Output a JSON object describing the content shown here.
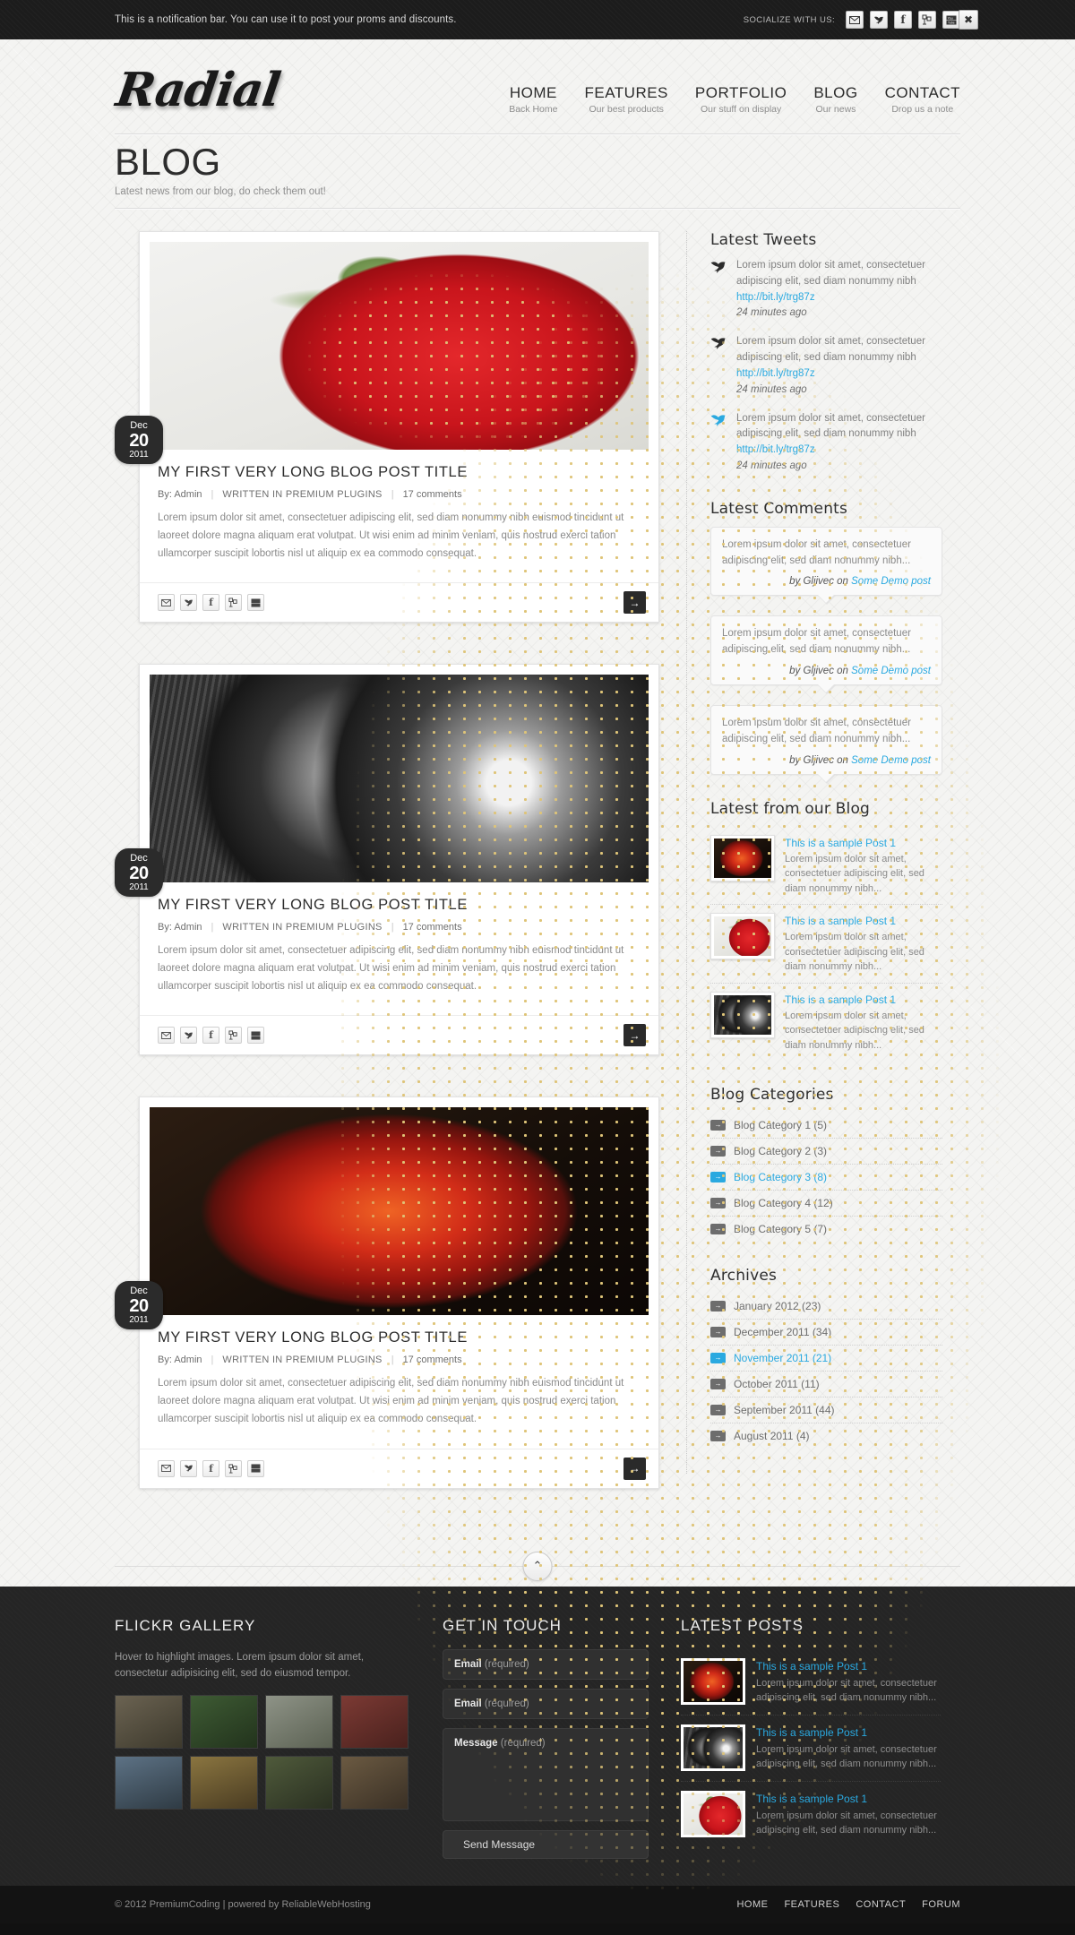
{
  "notification": {
    "text": "This is a notification bar. You can use it to post your proms and discounts.",
    "socialize_label": "SOCIALIZE WITH US:",
    "icons": [
      "mail-icon",
      "twitter-icon",
      "facebook-icon",
      "flickr-icon",
      "youtube-icon"
    ],
    "close_label": "✖"
  },
  "header": {
    "logo": "Radial",
    "nav": [
      {
        "title": "HOME",
        "sub": "Back Home"
      },
      {
        "title": "FEATURES",
        "sub": "Our best products"
      },
      {
        "title": "PORTFOLIO",
        "sub": "Our stuff on display"
      },
      {
        "title": "BLOG",
        "sub": "Our news"
      },
      {
        "title": "CONTACT",
        "sub": "Drop us a note"
      }
    ]
  },
  "page": {
    "title": "BLOG",
    "subtitle": "Latest news from our blog, do check them out!"
  },
  "posts": [
    {
      "image": "img-strawberry",
      "date": {
        "month": "Dec",
        "day": "20",
        "year": "2011"
      },
      "title": "MY FIRST VERY LONG BLOG POST TITLE",
      "author": "By: Admin",
      "category": "WRITTEN IN PREMIUM PLUGINS",
      "comments": "17 comments",
      "excerpt": "Lorem ipsum dolor sit amet, consectetuer adipiscing elit, sed diam nonummy nibh euismod tincidunt ut laoreet dolore magna aliquam erat volutpat. Ut wisi enim ad minim veniam, quis nostrud exerci tation ullamcorper suscipit lobortis nisl ut aliquip ex ea commodo consequat.",
      "readmore": "→"
    },
    {
      "image": "img-roses",
      "date": {
        "month": "Dec",
        "day": "20",
        "year": "2011"
      },
      "title": "MY FIRST VERY LONG BLOG POST TITLE",
      "author": "By: Admin",
      "category": "WRITTEN IN PREMIUM PLUGINS",
      "comments": "17 comments",
      "excerpt": "Lorem ipsum dolor sit amet, consectetuer adipiscing elit, sed diam nonummy nibh euismod tincidunt ut laoreet dolore magna aliquam erat volutpat. Ut wisi enim ad minim veniam, quis nostrud exerci tation ullamcorper suscipit lobortis nisl ut aliquip ex ea commodo consequat.",
      "readmore": "→"
    },
    {
      "image": "img-pomegranate",
      "date": {
        "month": "Dec",
        "day": "20",
        "year": "2011"
      },
      "title": "MY FIRST VERY LONG BLOG POST TITLE",
      "author": "By: Admin",
      "category": "WRITTEN IN PREMIUM PLUGINS",
      "comments": "17 comments",
      "excerpt": "Lorem ipsum dolor sit amet, consectetuer adipiscing elit, sed diam nonummy nibh euismod tincidunt ut laoreet dolore magna aliquam erat volutpat. Ut wisi enim ad minim veniam, quis nostrud exerci tation ullamcorper suscipit lobortis nisl ut aliquip ex ea commodo consequat.",
      "readmore": "→"
    }
  ],
  "sidebar": {
    "tweets_title": "Latest Tweets",
    "tweets": [
      {
        "text": "Lorem ipsum dolor sit amet, consectetuer adipiscing elit, sed diam nonummy nibh",
        "link": "http://bit.ly/trg87z",
        "time": "24 minutes ago",
        "highlight": false
      },
      {
        "text": "Lorem ipsum dolor sit amet, consectetuer adipiscing elit, sed diam nonummy nibh",
        "link": "http://bit.ly/trg87z",
        "time": "24 minutes ago",
        "highlight": false
      },
      {
        "text": "Lorem ipsum dolor sit amet, consectetuer adipiscing elit, sed diam nonummy nibh",
        "link": "http://bit.ly/trg87z",
        "time": "24 minutes ago",
        "highlight": true
      }
    ],
    "comments_title": "Latest Comments",
    "comments": [
      {
        "text": "Lorem ipsum dolor sit amet, consectetuer adipiscing elit, sed diam nonummy nibh...",
        "by": "by Gljivec on ",
        "post": "Some Demo post"
      },
      {
        "text": "Lorem ipsum dolor sit amet, consectetuer adipiscing elit, sed diam nonummy nibh...",
        "by": "by Gljivec on ",
        "post": "Some Demo post"
      },
      {
        "text": "Lorem ipsum dolor sit amet, consectetuer adipiscing elit, sed diam nonummy nibh...",
        "by": "by Gljivec on ",
        "post": "Some Demo post"
      }
    ],
    "latest_blog_title": "Latest from our Blog",
    "latest_blog": [
      {
        "image": "img-pomegranate",
        "title": "This is a sample Post 1",
        "text": "Lorem ipsum dolor sit amet, consectetuer adipiscing elit, sed diam nonummy nibh..."
      },
      {
        "image": "img-strawberry",
        "title": "This is a sample Post 1",
        "text": "Lorem ipsum dolor sit amet, consectetuer adipiscing elit, sed diam nonummy nibh..."
      },
      {
        "image": "img-roses",
        "title": "This is a sample Post 1",
        "text": "Lorem ipsum dolor sit amet, consectetuer adipiscing elit, sed diam nonummy nibh..."
      }
    ],
    "categories_title": "Blog Categories",
    "categories": [
      {
        "label": "Blog Category 1 (5)",
        "active": false
      },
      {
        "label": "Blog Category 2 (3)",
        "active": false
      },
      {
        "label": "Blog Category 3 (8)",
        "active": true
      },
      {
        "label": "Blog Category 4 (12)",
        "active": false
      },
      {
        "label": "Blog Category 5 (7)",
        "active": false
      }
    ],
    "archives_title": "Archives",
    "archives": [
      {
        "label": "January 2012 (23)",
        "active": false
      },
      {
        "label": "December 2011 (34)",
        "active": false
      },
      {
        "label": "November 2011 (21)",
        "active": true
      },
      {
        "label": "October 2011 (11)",
        "active": false
      },
      {
        "label": "September 2011 (44)",
        "active": false
      },
      {
        "label": "August 2011 (4)",
        "active": false
      }
    ]
  },
  "scroll_top": {
    "label": "⌃"
  },
  "footer": {
    "flickr_title": "FLICKR GALLERY",
    "flickr_desc": "Hover to highlight images. Lorem ipsum dolor sit amet, consectetur adipisicing elit, sed do eiusmod tempor.",
    "flickr_items": [
      "fk1",
      "fk2",
      "fk3",
      "fk4",
      "fk5",
      "fk6",
      "fk7",
      "fk8"
    ],
    "contact_title": "GET IN TOUCH",
    "field1_label": "Email",
    "field1_hint": " (required)",
    "field2_label": "Email",
    "field2_hint": " (required)",
    "field3_label": "Message",
    "field3_hint": " (required)",
    "send_label": "Send Message",
    "posts_title": "LATEST POSTS",
    "posts": [
      {
        "image": "img-pomegranate",
        "title": "This is a sample Post 1",
        "text": "Lorem ipsum dolor sit amet, consectetuer adipiscing elit, sed diam nonummy nibh..."
      },
      {
        "image": "img-roses",
        "title": "This is a sample Post 1",
        "text": "Lorem ipsum dolor sit amet, consectetuer adipiscing elit, sed diam nonummy nibh..."
      },
      {
        "image": "img-strawberry",
        "title": "This is a sample Post 1",
        "text": "Lorem ipsum dolor sit amet, consectetuer adipiscing elit, sed diam nonummy nibh..."
      }
    ]
  },
  "copyright": {
    "text": "© 2012 PremiumCoding | powered by ReliableWebHosting",
    "nav": [
      "HOME",
      "FEATURES",
      "CONTACT",
      "FORUM"
    ]
  },
  "colors": {
    "accent": "#2aa9e0",
    "dark": "#2b2b2b",
    "footer": "#252525"
  }
}
